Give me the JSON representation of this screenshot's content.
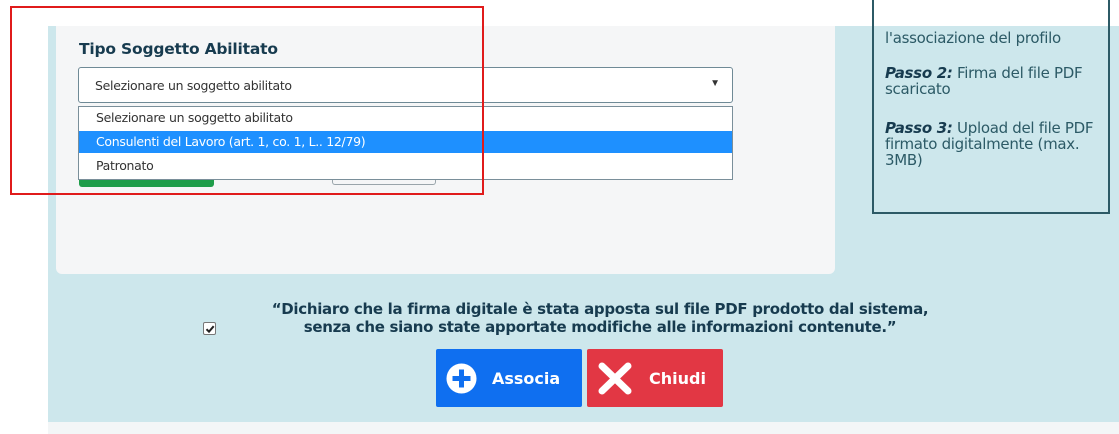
{
  "form": {
    "field_label": "Tipo Soggetto Abilitato",
    "select": {
      "value": "Selezionare un soggetto abilitato",
      "caret": "▼",
      "options": [
        "Selezionare un soggetto abilitato",
        "Consulenti del Lavoro (art. 1, co. 1, L.. 12/79)",
        "Patronato"
      ],
      "highlighted_option": "Consulenti del Lavoro (art. 1, co. 1, L.. 12/79)"
    }
  },
  "steps": {
    "step1_tail": "l'associazione del profilo",
    "step2_lead": "Passo 2:",
    "step2_text": " Firma del file PDF scaricato",
    "step3_lead": "Passo 3:",
    "step3_text": " Upload del file PDF firmato digitalmente (max. 3MB)"
  },
  "declaration": {
    "checked": true,
    "line1": "“Dichiaro che la firma digitale è stata apposta sul file PDF prodotto dal sistema,",
    "line2": "senza che siano state apportate modifiche alle informazioni contenute.”"
  },
  "buttons": {
    "associa_label": "Associa",
    "associa_icon": "plus-circle-icon",
    "chiudi_label": "Chiudi",
    "chiudi_icon": "close-x-icon"
  },
  "colors": {
    "page_background": "#cde7ec",
    "heading": "#173b4f",
    "select_highlight": "#1e90ff",
    "associa_button": "#0f6ff0",
    "chiudi_button": "#e23744",
    "annotation_border": "#e01b1b"
  }
}
